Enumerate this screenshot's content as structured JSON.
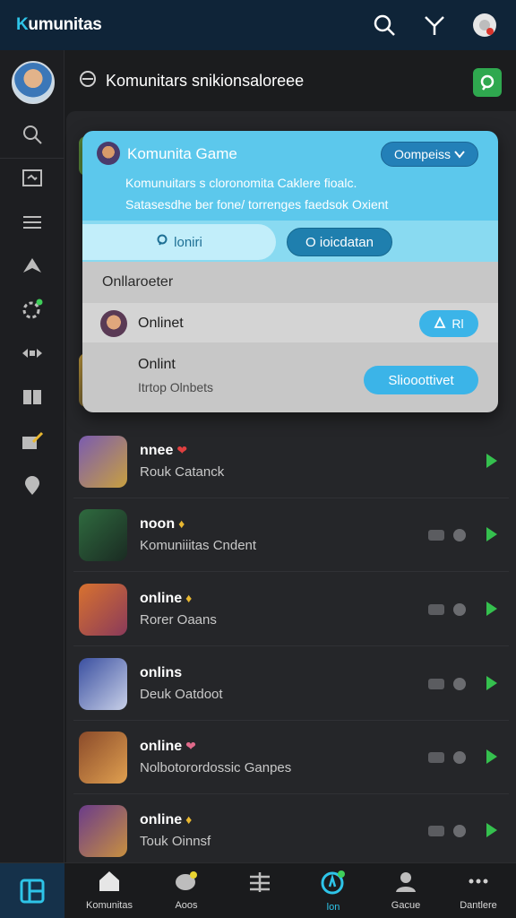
{
  "app": {
    "logo_prefix": "K",
    "logo_rest": "umunitas"
  },
  "topbar": {
    "icons": [
      "search-icon",
      "filter-icon",
      "settings-gear-icon"
    ]
  },
  "rail": {
    "icons": [
      "avatar",
      "search-icon",
      "chat-icon",
      "menu-lines-icon",
      "bookmark-icon",
      "gear-icon",
      "arrows-icon",
      "cards-icon",
      "edit-icon",
      "location-pin-icon"
    ]
  },
  "subheader": {
    "title": "Komunitars snikionsaloreee"
  },
  "popup": {
    "title": "Komunita Game",
    "dropdown": "Oompeiss",
    "desc_line1": "Komunuitars s cloronomita Caklere fioalc.",
    "desc_line2": "Satasesdhe ber fone/ torrenges faedsok Oxient",
    "tab1_label": "loniri",
    "tab2_label": "O ioicdatan",
    "section_title": "Onllaroeter",
    "item_name": "Onlinet",
    "item_button": "Rl",
    "item2_name": "Onlint",
    "item2_sub": "Itrtop Olnbets",
    "item2_button": "Sliooottivet"
  },
  "list": {
    "rows": [
      {
        "name": "nnee",
        "tag": "❤",
        "sub": "Rouk Catanck",
        "toggles": false,
        "thumb_color": "#7a5bb0"
      },
      {
        "name": "noon",
        "tag": "♦",
        "sub": "Komuniiitas Cndent",
        "toggles": true,
        "thumb_color": "#2f6b3f"
      },
      {
        "name": "online",
        "tag": "♦",
        "sub": "Rorer Oaans",
        "toggles": true,
        "thumb_color": "#d8722f"
      },
      {
        "name": "onlins",
        "tag": "",
        "sub": "Deuk Oatdoot",
        "toggles": true,
        "thumb_color": "#3a4fa0"
      },
      {
        "name": "online",
        "tag": "❤",
        "sub": "Nolbotorordossic Ganpes",
        "toggles": true,
        "thumb_color": "#8a4a2a"
      },
      {
        "name": "online",
        "tag": "♦",
        "sub": "Touk Oinnsf",
        "toggles": true,
        "thumb_color": "#6a3b8a"
      }
    ]
  },
  "bottomnav": {
    "items": [
      {
        "label": "Komunitas",
        "icon": "home-icon"
      },
      {
        "label": "Aoos",
        "icon": "chat-bubble-icon"
      },
      {
        "label": "",
        "icon": "list-icon"
      },
      {
        "label": "lon",
        "icon": "compass-icon"
      },
      {
        "label": "Gacue",
        "icon": "profile-icon"
      },
      {
        "label": "Dantlere",
        "icon": "more-icon"
      }
    ]
  },
  "colors": {
    "accent": "#2ec4e8",
    "green": "#2fa84f",
    "popup_head": "#5cc8ec",
    "button_blue": "#3bb4e8"
  }
}
